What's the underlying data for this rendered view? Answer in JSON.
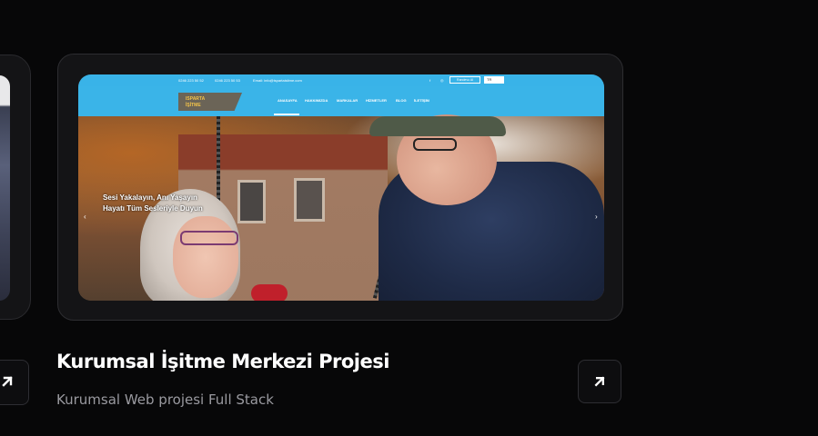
{
  "project": {
    "title": "Kurumsal İşitme Merkezi Projesi",
    "subtitle": "Kurumsal Web projesi Full Stack"
  },
  "preview": {
    "topbar": {
      "phone1": "0246 223 50 52",
      "phone2": "0246 223 50 53",
      "email": "Email: info@ispartaisitme.com",
      "quote_button": "Randevu Al",
      "language": "TR"
    },
    "logo_text": [
      "ISPARTA",
      "İŞİTME"
    ],
    "nav": [
      "ANASAYFA",
      "HAKKIMIZDA",
      "MARKALAR",
      "HİZMETLER",
      "BLOG",
      "İLETİŞİM"
    ],
    "hero": {
      "line1": "Sesi Yakalayın, Anı Yaşayın",
      "line2": "Hayatı Tüm Sesleriyle Duyun"
    }
  },
  "icons": {
    "arrow": "arrow-up-right-icon",
    "prev": "chevron-left-icon",
    "next": "chevron-right-icon"
  },
  "colors": {
    "background": "#070708",
    "card": "#141416",
    "preview_header": "#39b3e8",
    "subtitle": "#9a9aa0"
  }
}
